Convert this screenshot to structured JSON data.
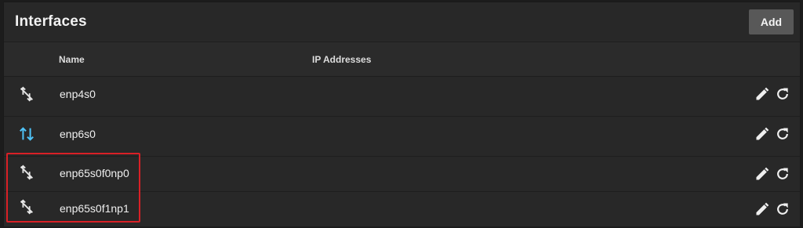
{
  "card": {
    "title": "Interfaces",
    "add_label": "Add"
  },
  "columns": {
    "name": "Name",
    "ip_addresses": "IP Addresses"
  },
  "interfaces": [
    {
      "name": "enp4s0",
      "ip": "",
      "status_icon": "link-down-icon"
    },
    {
      "name": "enp6s0",
      "ip": "",
      "status_icon": "link-up-icon"
    },
    {
      "name": "enp65s0f0np0",
      "ip": "",
      "status_icon": "link-down-icon"
    },
    {
      "name": "enp65s0f1np1",
      "ip": "",
      "status_icon": "link-down-icon"
    }
  ],
  "row_actions": [
    "pencil-icon",
    "refresh-icon"
  ],
  "colors": {
    "background": "#1c1c1c",
    "card": "#282828",
    "add_button": "#585858",
    "link_up": "#4fc3f7",
    "highlight": "#d92026"
  }
}
